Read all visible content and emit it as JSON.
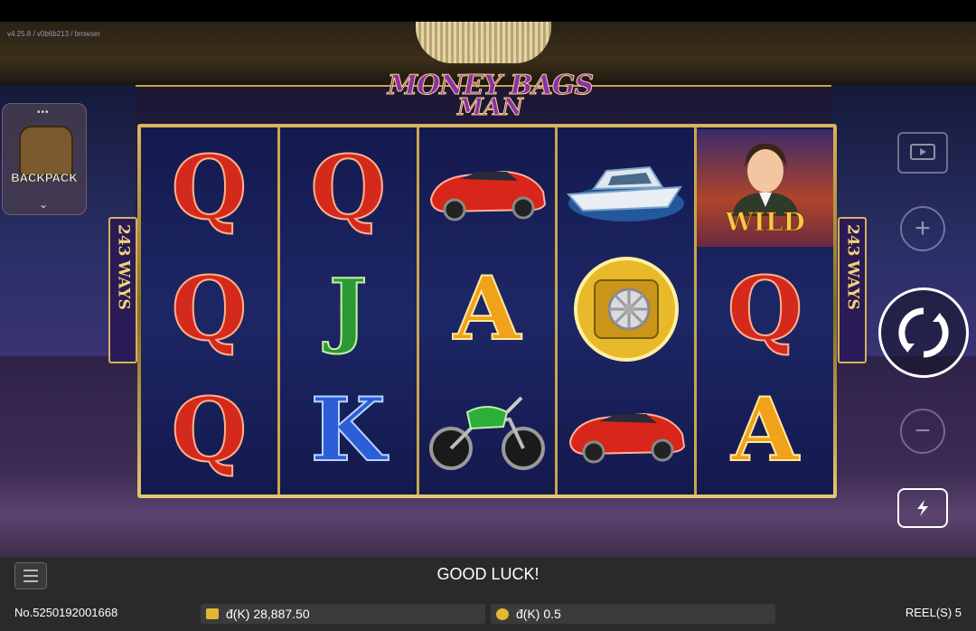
{
  "version_text": "v4.25.8 / v0b6b213 / browser",
  "game_title": {
    "line1": "MONEY BAGS",
    "line2": "MAN"
  },
  "ways_label": {
    "count": "243",
    "word": "WAYS"
  },
  "feature": {
    "label": "BACKPACK",
    "icon": "backpack-icon"
  },
  "reels": [
    [
      "Q",
      "Q",
      "Q"
    ],
    [
      "Q",
      "J",
      "K"
    ],
    [
      "car",
      "A",
      "motorbike"
    ],
    [
      "yacht",
      "vault",
      "car"
    ],
    [
      "wild-man",
      "Q",
      "A"
    ]
  ],
  "wild_label": "WILD",
  "controls": {
    "screen_icon": "screen-icon",
    "bet_up_icon": "plus-icon",
    "spin_icon": "spin-icon",
    "bet_down_icon": "minus-icon",
    "turbo_icon": "turbo-icon",
    "menu_icon": "menu-icon"
  },
  "status": {
    "message": "GOOD LUCK!",
    "ticket_no": "No.5250192001668",
    "balance": "đ(K) 28,887.50",
    "bet": "đ(K) 0.5",
    "reels": "REEL(S) 5"
  },
  "colors": {
    "frame_gold": "#d4b15a",
    "reel_bg": "#14194d",
    "bottom_bar": "#2a2a2a"
  }
}
